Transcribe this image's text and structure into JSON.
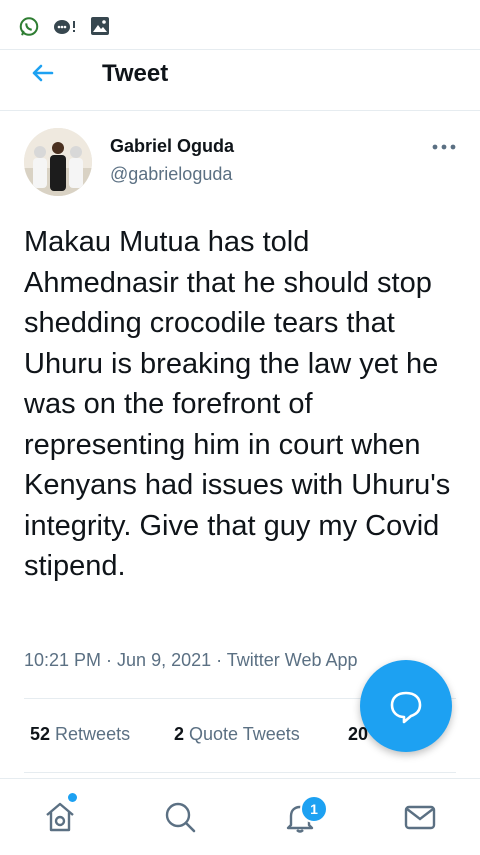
{
  "header": {
    "title": "Tweet"
  },
  "tweet": {
    "author_name": "Gabriel Oguda",
    "author_handle": "@gabrieloguda",
    "text": "Makau Mutua has told Ahmednasir that he should stop shedding crocodile tears that Uhuru is breaking the law yet he was on the forefront of representing him in court when Kenyans had issues with Uhuru's integrity. Give that guy my Covid stipend.",
    "timestamp": "10:21 PM · Jun 9, 2021 · Twitter Web App",
    "stats": {
      "retweets_count": "52",
      "retweets_label": "Retweets",
      "quote_count": "2",
      "quote_label": "Quote Tweets",
      "likes_count_partial": "20"
    }
  },
  "nav": {
    "notifications_badge": "1"
  },
  "colors": {
    "accent": "#1da1f2",
    "text": "#0f1419",
    "muted": "#5b7083",
    "divider": "#e6ecf0"
  }
}
